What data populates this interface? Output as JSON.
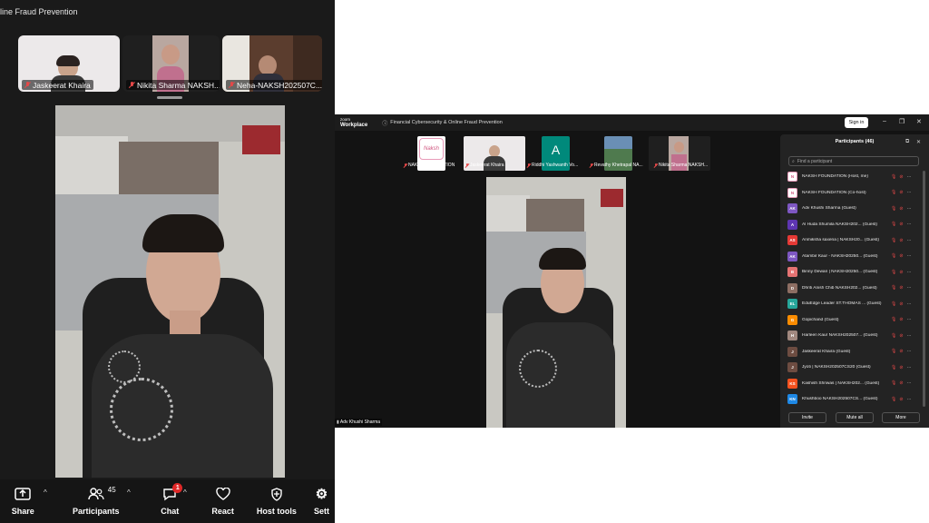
{
  "left_window": {
    "meeting_title": "line Fraud Prevention",
    "tiles": [
      {
        "name": "Jaskeerat Khaira"
      },
      {
        "name": "Nikita Sharma NAKSH..."
      },
      {
        "name": "Neha-NAKSH202507C..."
      }
    ],
    "toolbar": {
      "share": "Share",
      "participants": "Participants",
      "participants_count": "45",
      "chat": "Chat",
      "chat_badge": "1",
      "react": "React",
      "host_tools": "Host tools",
      "settings": "Sett"
    }
  },
  "right_window": {
    "app_logo_line1": "zoom",
    "app_logo_line2": "Workplace",
    "meeting_title": "Financial Cybersecurity & Online Fraud Prevention",
    "sign_in": "Sign in",
    "tiles": [
      {
        "name": "NAKSH FOUNDATION",
        "logo_text": "Naksh"
      },
      {
        "name": "Jaskeerat Khaira"
      },
      {
        "name": "Riddhi Yashwanth Vo...",
        "avatar_letter": "A"
      },
      {
        "name": "Revathy Khetrapal NA..."
      },
      {
        "name": "Nikita Sharma NAKSH..."
      }
    ],
    "self_view_name": "Adv Khushi Sharma",
    "participants_panel": {
      "header": "Participants (46)",
      "search_placeholder": "Find a participant",
      "rows": [
        {
          "initials": "N",
          "name": "NAKSH FOUNDATION (Host, me)",
          "color": "#ffffff"
        },
        {
          "initials": "N",
          "name": "NAKSH FOUNDATION (Co-host)",
          "color": "#ffffff"
        },
        {
          "initials": "AK",
          "name": "Adv Khushi Sharma (Guest)",
          "color": "#7e57c2"
        },
        {
          "initials": "A",
          "name": "Al Huda Shumila NAKSH202... (Guest)",
          "color": "#5e35b1"
        },
        {
          "initials": "AS",
          "name": "Anmiksha saxena | NAKSH20... (Guest)",
          "color": "#e53935"
        },
        {
          "initials": "AK",
          "name": "Atambir Kaur - NAKSH20250... (Guest)",
          "color": "#7e57c2"
        },
        {
          "initials": "B",
          "name": "Binny Dewan | NAKSH20250... (Guest)",
          "color": "#e57373"
        },
        {
          "initials": "D",
          "name": "Dhriti Anish Chib NAKSH202... (Guest)",
          "color": "#8d6e63"
        },
        {
          "initials": "EL",
          "name": "EduEdge Leader ST.THOMAS ... (Guest)",
          "color": "#26a69a"
        },
        {
          "initials": "G",
          "name": "Gopichand (Guest)",
          "color": "#fb8c00"
        },
        {
          "initials": "H",
          "name": "Harleen Kaur NAKSH202507... (Guest)",
          "color": "#a1887f"
        },
        {
          "initials": "J",
          "name": "Jaskeerat Khaira (Guest)",
          "color": "#6d4c41"
        },
        {
          "initials": "J",
          "name": "Jyoti | NAKSH202507CS20 (Guest)",
          "color": "#6d4c41"
        },
        {
          "initials": "KS",
          "name": "Kashish Shriwas | NAKSH202... (Guest)",
          "color": "#f4511e"
        },
        {
          "initials": "KN",
          "name": "Khushboo NAKSH202507CS... (Guest)",
          "color": "#1e88e5"
        }
      ],
      "invite": "Invite",
      "mute_all": "Mute all",
      "more": "More"
    }
  }
}
